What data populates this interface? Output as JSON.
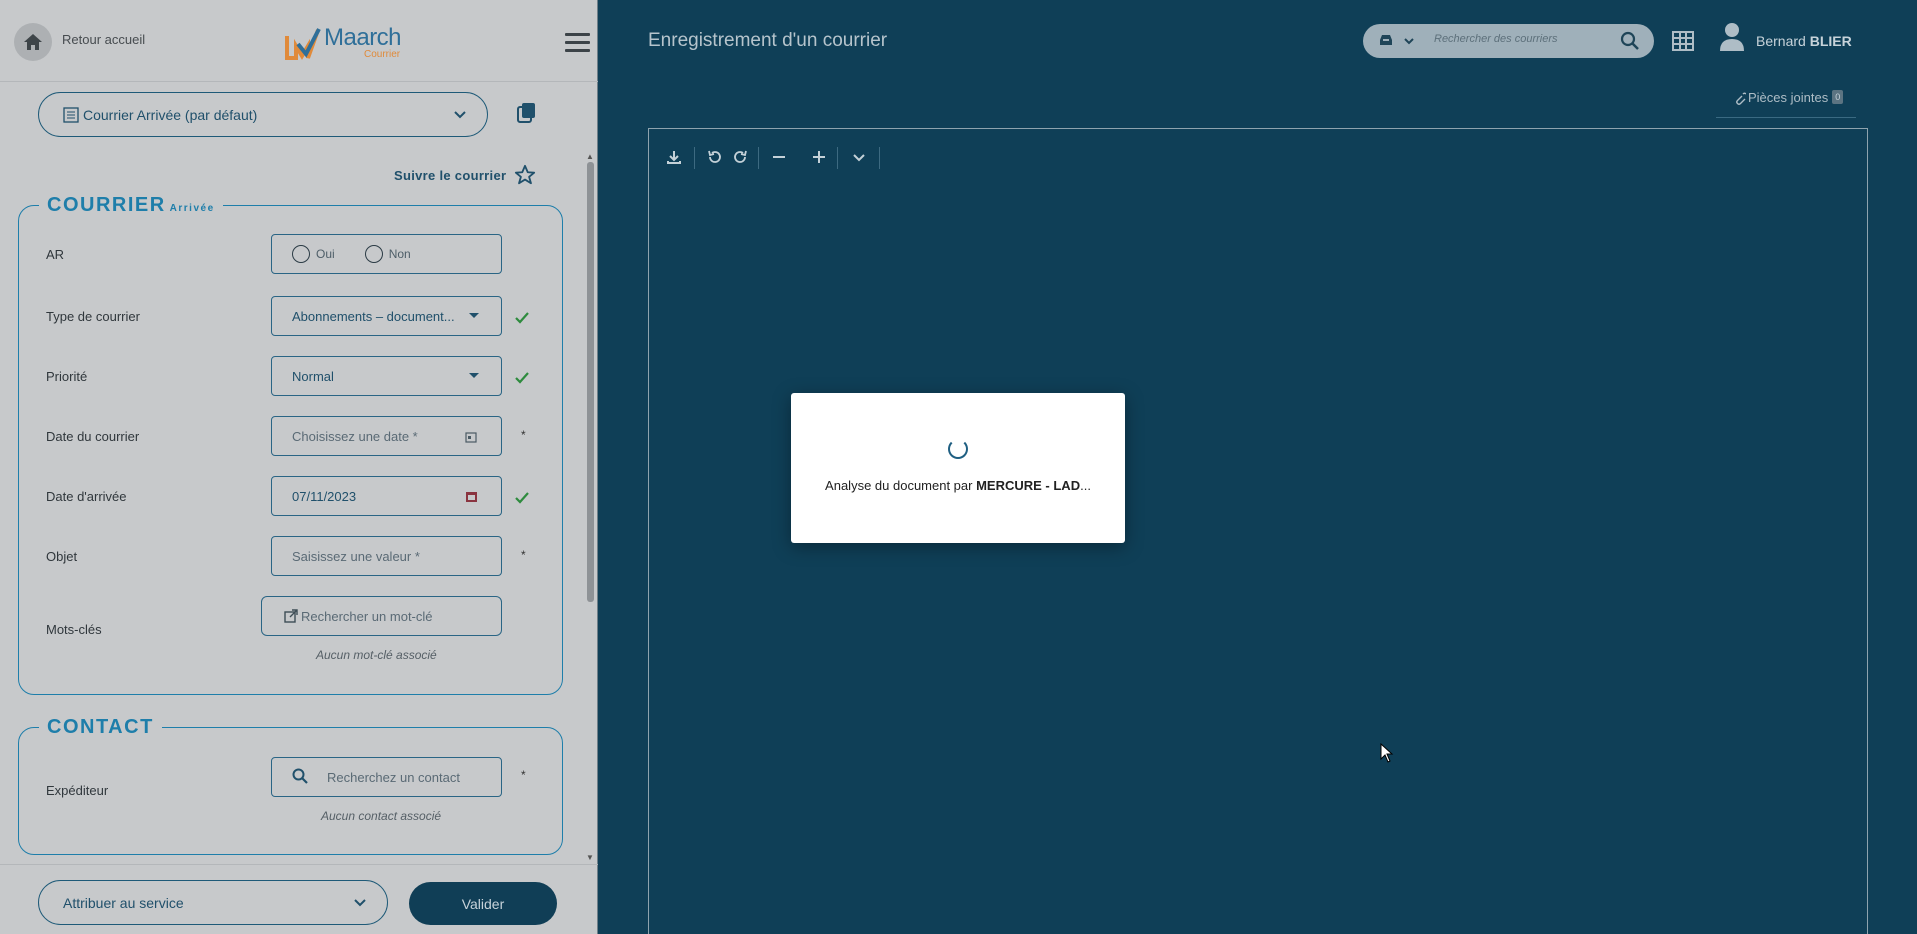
{
  "header": {
    "home_label": "Retour accueil",
    "logo_name": "Maarch",
    "logo_sub": "Courrier",
    "page_title": "Enregistrement d'un courrier",
    "search_placeholder": "Rechercher des courriers",
    "user_first": "Bernard",
    "user_last": "BLIER"
  },
  "model_select": {
    "value": "Courrier Arrivée (par défaut)"
  },
  "follow_label": "Suivre le courrier",
  "courrier": {
    "legend": "COURRIER",
    "legend_sub": "Arrivée",
    "fields": {
      "ar": {
        "label": "AR",
        "options": [
          "Oui",
          "Non"
        ]
      },
      "type": {
        "label": "Type de courrier",
        "value": "Abonnements – document..."
      },
      "priority": {
        "label": "Priorité",
        "value": "Normal"
      },
      "doc_date": {
        "label": "Date du courrier",
        "placeholder": "Choisissez une date *"
      },
      "arrival_date": {
        "label": "Date d'arrivée",
        "value": "07/11/2023"
      },
      "subject": {
        "label": "Objet",
        "placeholder": "Saisissez une valeur *"
      },
      "keywords": {
        "label": "Mots-clés",
        "button": "Rechercher un mot-clé",
        "empty": "Aucun mot-clé associé"
      }
    }
  },
  "contact": {
    "legend": "CONTACT",
    "sender": {
      "label": "Expéditeur",
      "placeholder": "Recherchez un contact",
      "empty": "Aucun contact associé"
    }
  },
  "footer": {
    "assign": "Attribuer au service",
    "validate": "Valider"
  },
  "attachments": {
    "label": "Pièces jointes",
    "count": "0"
  },
  "modal": {
    "text_prefix": "Analyse du document par ",
    "text_bold": "MERCURE - LAD",
    "text_suffix": "..."
  },
  "colors": {
    "dark_bg": "#0f3f57",
    "accent": "#1e7eaa",
    "check": "#2e8b3e"
  }
}
